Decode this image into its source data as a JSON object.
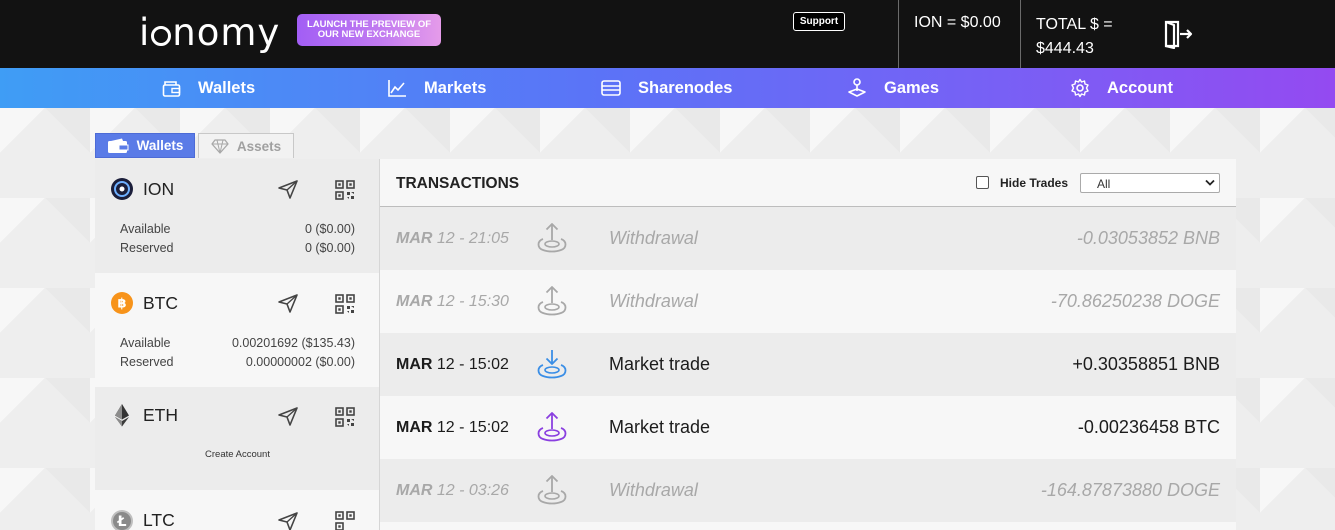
{
  "brand": {
    "logo_text_prefix": "i",
    "logo_text_suffix": "nomy"
  },
  "header": {
    "launch_label": "LAUNCH THE PREVIEW OF OUR NEW EXCHANGE",
    "support_label": "Support",
    "ion_price": "ION = $0.00",
    "total_label": "TOTAL $ =",
    "total_value": "$444.43",
    "logout_icon": "logout-icon"
  },
  "nav": {
    "items": [
      {
        "label": "Wallets",
        "icon": "wallet-icon"
      },
      {
        "label": "Markets",
        "icon": "chart-icon"
      },
      {
        "label": "Sharenodes",
        "icon": "server-icon"
      },
      {
        "label": "Games",
        "icon": "joystick-icon"
      },
      {
        "label": "Account",
        "icon": "gear-icon"
      }
    ]
  },
  "tabs": {
    "wallets": "Wallets",
    "assets": "Assets"
  },
  "wallets": [
    {
      "coin": "ION",
      "available_label": "Available",
      "available_value": "0 ($0.00)",
      "reserved_label": "Reserved",
      "reserved_value": "0 ($0.00)"
    },
    {
      "coin": "BTC",
      "available_label": "Available",
      "available_value": "0.00201692 ($135.43)",
      "reserved_label": "Reserved",
      "reserved_value": "0.00000002 ($0.00)"
    },
    {
      "coin": "ETH",
      "create_label": "Create Account"
    },
    {
      "coin": "LTC"
    }
  ],
  "transactions": {
    "title": "TRANSACTIONS",
    "hide_trades_label": "Hide Trades",
    "hide_trades_checked": false,
    "filter_value": "All",
    "rows": [
      {
        "date_bold": "MAR",
        "date_rest": " 12 - 21:05",
        "type": "Withdrawal",
        "amount": "-0.03053852 BNB",
        "status": "muted",
        "icon_color": "#a8a8a8",
        "direction": "out"
      },
      {
        "date_bold": "MAR",
        "date_rest": " 12 - 15:30",
        "type": "Withdrawal",
        "amount": "-70.86250238 DOGE",
        "status": "muted",
        "icon_color": "#a8a8a8",
        "direction": "out"
      },
      {
        "date_bold": "MAR",
        "date_rest": " 12 - 15:02",
        "type": "Market trade",
        "amount": "+0.30358851 BNB",
        "status": "active",
        "icon_color": "#3a8ee6",
        "direction": "in"
      },
      {
        "date_bold": "MAR",
        "date_rest": " 12 - 15:02",
        "type": "Market trade",
        "amount": "-0.00236458 BTC",
        "status": "active",
        "icon_color": "#8a3fe0",
        "direction": "out"
      },
      {
        "date_bold": "MAR",
        "date_rest": " 12 - 03:26",
        "type": "Withdrawal",
        "amount": "-164.87873880 DOGE",
        "status": "muted",
        "icon_color": "#a8a8a8",
        "direction": "out"
      }
    ]
  },
  "colors": {
    "topbar": "#121212",
    "nav_start": "#3f9df5",
    "nav_end": "#944af1",
    "tab_active": "#5a7be7",
    "btc": "#f7931a"
  }
}
